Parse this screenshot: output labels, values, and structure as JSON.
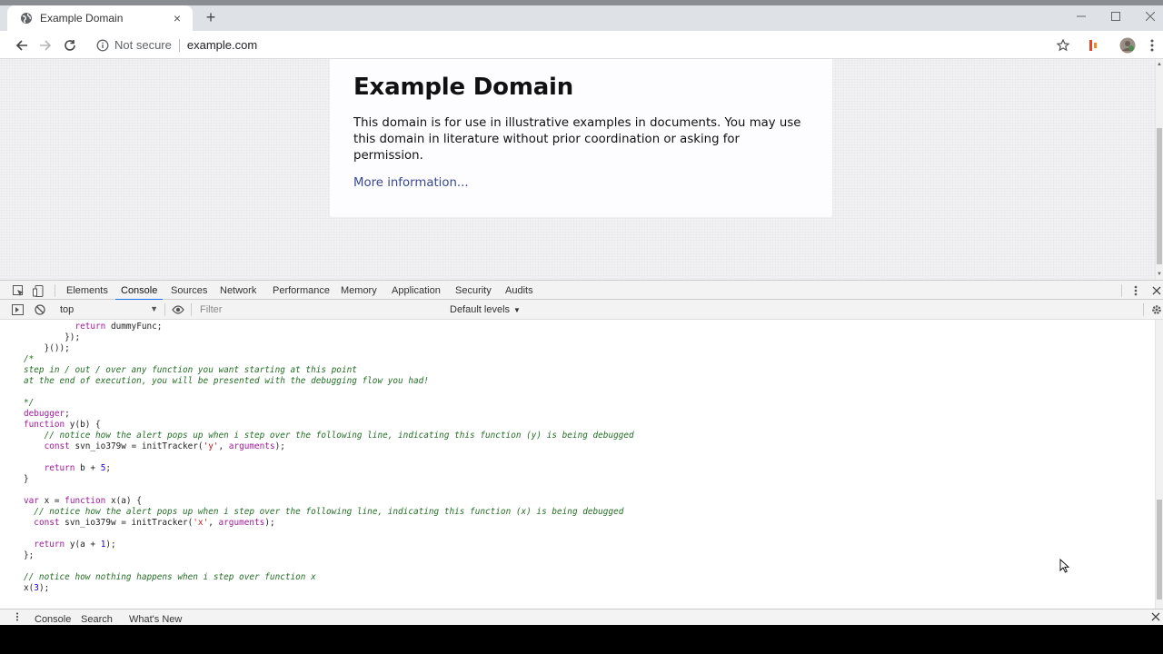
{
  "browser": {
    "tab_title": "Example Domain",
    "tab_close_glyph": "×",
    "new_tab_glyph": "+",
    "security_label": "Not secure",
    "url": "example.com"
  },
  "page": {
    "heading": "Example Domain",
    "paragraph": "This domain is for use in illustrative examples in documents. You may use this domain in literature without prior coordination or asking for permission.",
    "link": "More information..."
  },
  "devtools": {
    "tabs": [
      "Elements",
      "Console",
      "Sources",
      "Network",
      "Performance",
      "Memory",
      "Application",
      "Security",
      "Audits"
    ],
    "active_tab": "Console",
    "context": "top",
    "filter_placeholder": "Filter",
    "levels": "Default levels",
    "drawer_tabs": [
      "Console",
      "Search",
      "What's New"
    ]
  },
  "colors": {
    "accent": "#1a73e8",
    "keyword": "#a0199a",
    "comment": "#236e25",
    "string": "#c41a16",
    "link": "#38488f"
  }
}
